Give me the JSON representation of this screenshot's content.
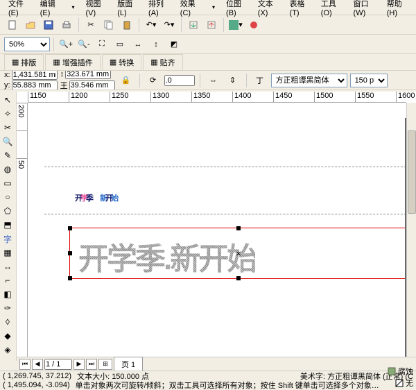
{
  "menu": [
    "文件(E)",
    "编辑(E)",
    "视图(V)",
    "版面(L)",
    "排列(A)",
    "效果(C)",
    "位图(B)",
    "文本(X)",
    "表格(T)",
    "工具(O)",
    "窗口(W)",
    "帮助(H)"
  ],
  "zoom": "50%",
  "tabs": [
    "排版",
    "增强插件",
    "转换",
    "贴齐"
  ],
  "pos": {
    "x": "1,431.581 mm",
    "y": "55.883 mm",
    "w": "323.671 mm",
    "h": "39.546 mm"
  },
  "rotate": ".0",
  "font": "方正粗谭黑简体",
  "fontsize": "150 pt",
  "page": {
    "cur": "1 / 1",
    "tab": "页 1"
  },
  "ruler_h": [
    "1150",
    "1200",
    "1250",
    "1300",
    "1350",
    "1400",
    "1450",
    "1500",
    "1550",
    "1600"
  ],
  "ruler_v": [
    "200",
    "",
    "50"
  ],
  "art": {
    "a": "开",
    "b": "学",
    "c": "季",
    "d": "新",
    "e": "开",
    "f": "始"
  },
  "art2": "开学季.新开始",
  "status": {
    "l1a": "( 1,269.745, 37.212)",
    "l1b": "文本大小: 150.000 点",
    "l1r": "美术字: 方正粗谭黑简体 (正常) (C",
    "l2a": "( 1,495.094, -3.094)",
    "l2b": "单击对象两次可旋转/倾斜；双击工具可选择所有对象；按住 Shift 键单击可选择多个对象…",
    "r1": "腐蚀",
    "r2": "无"
  }
}
